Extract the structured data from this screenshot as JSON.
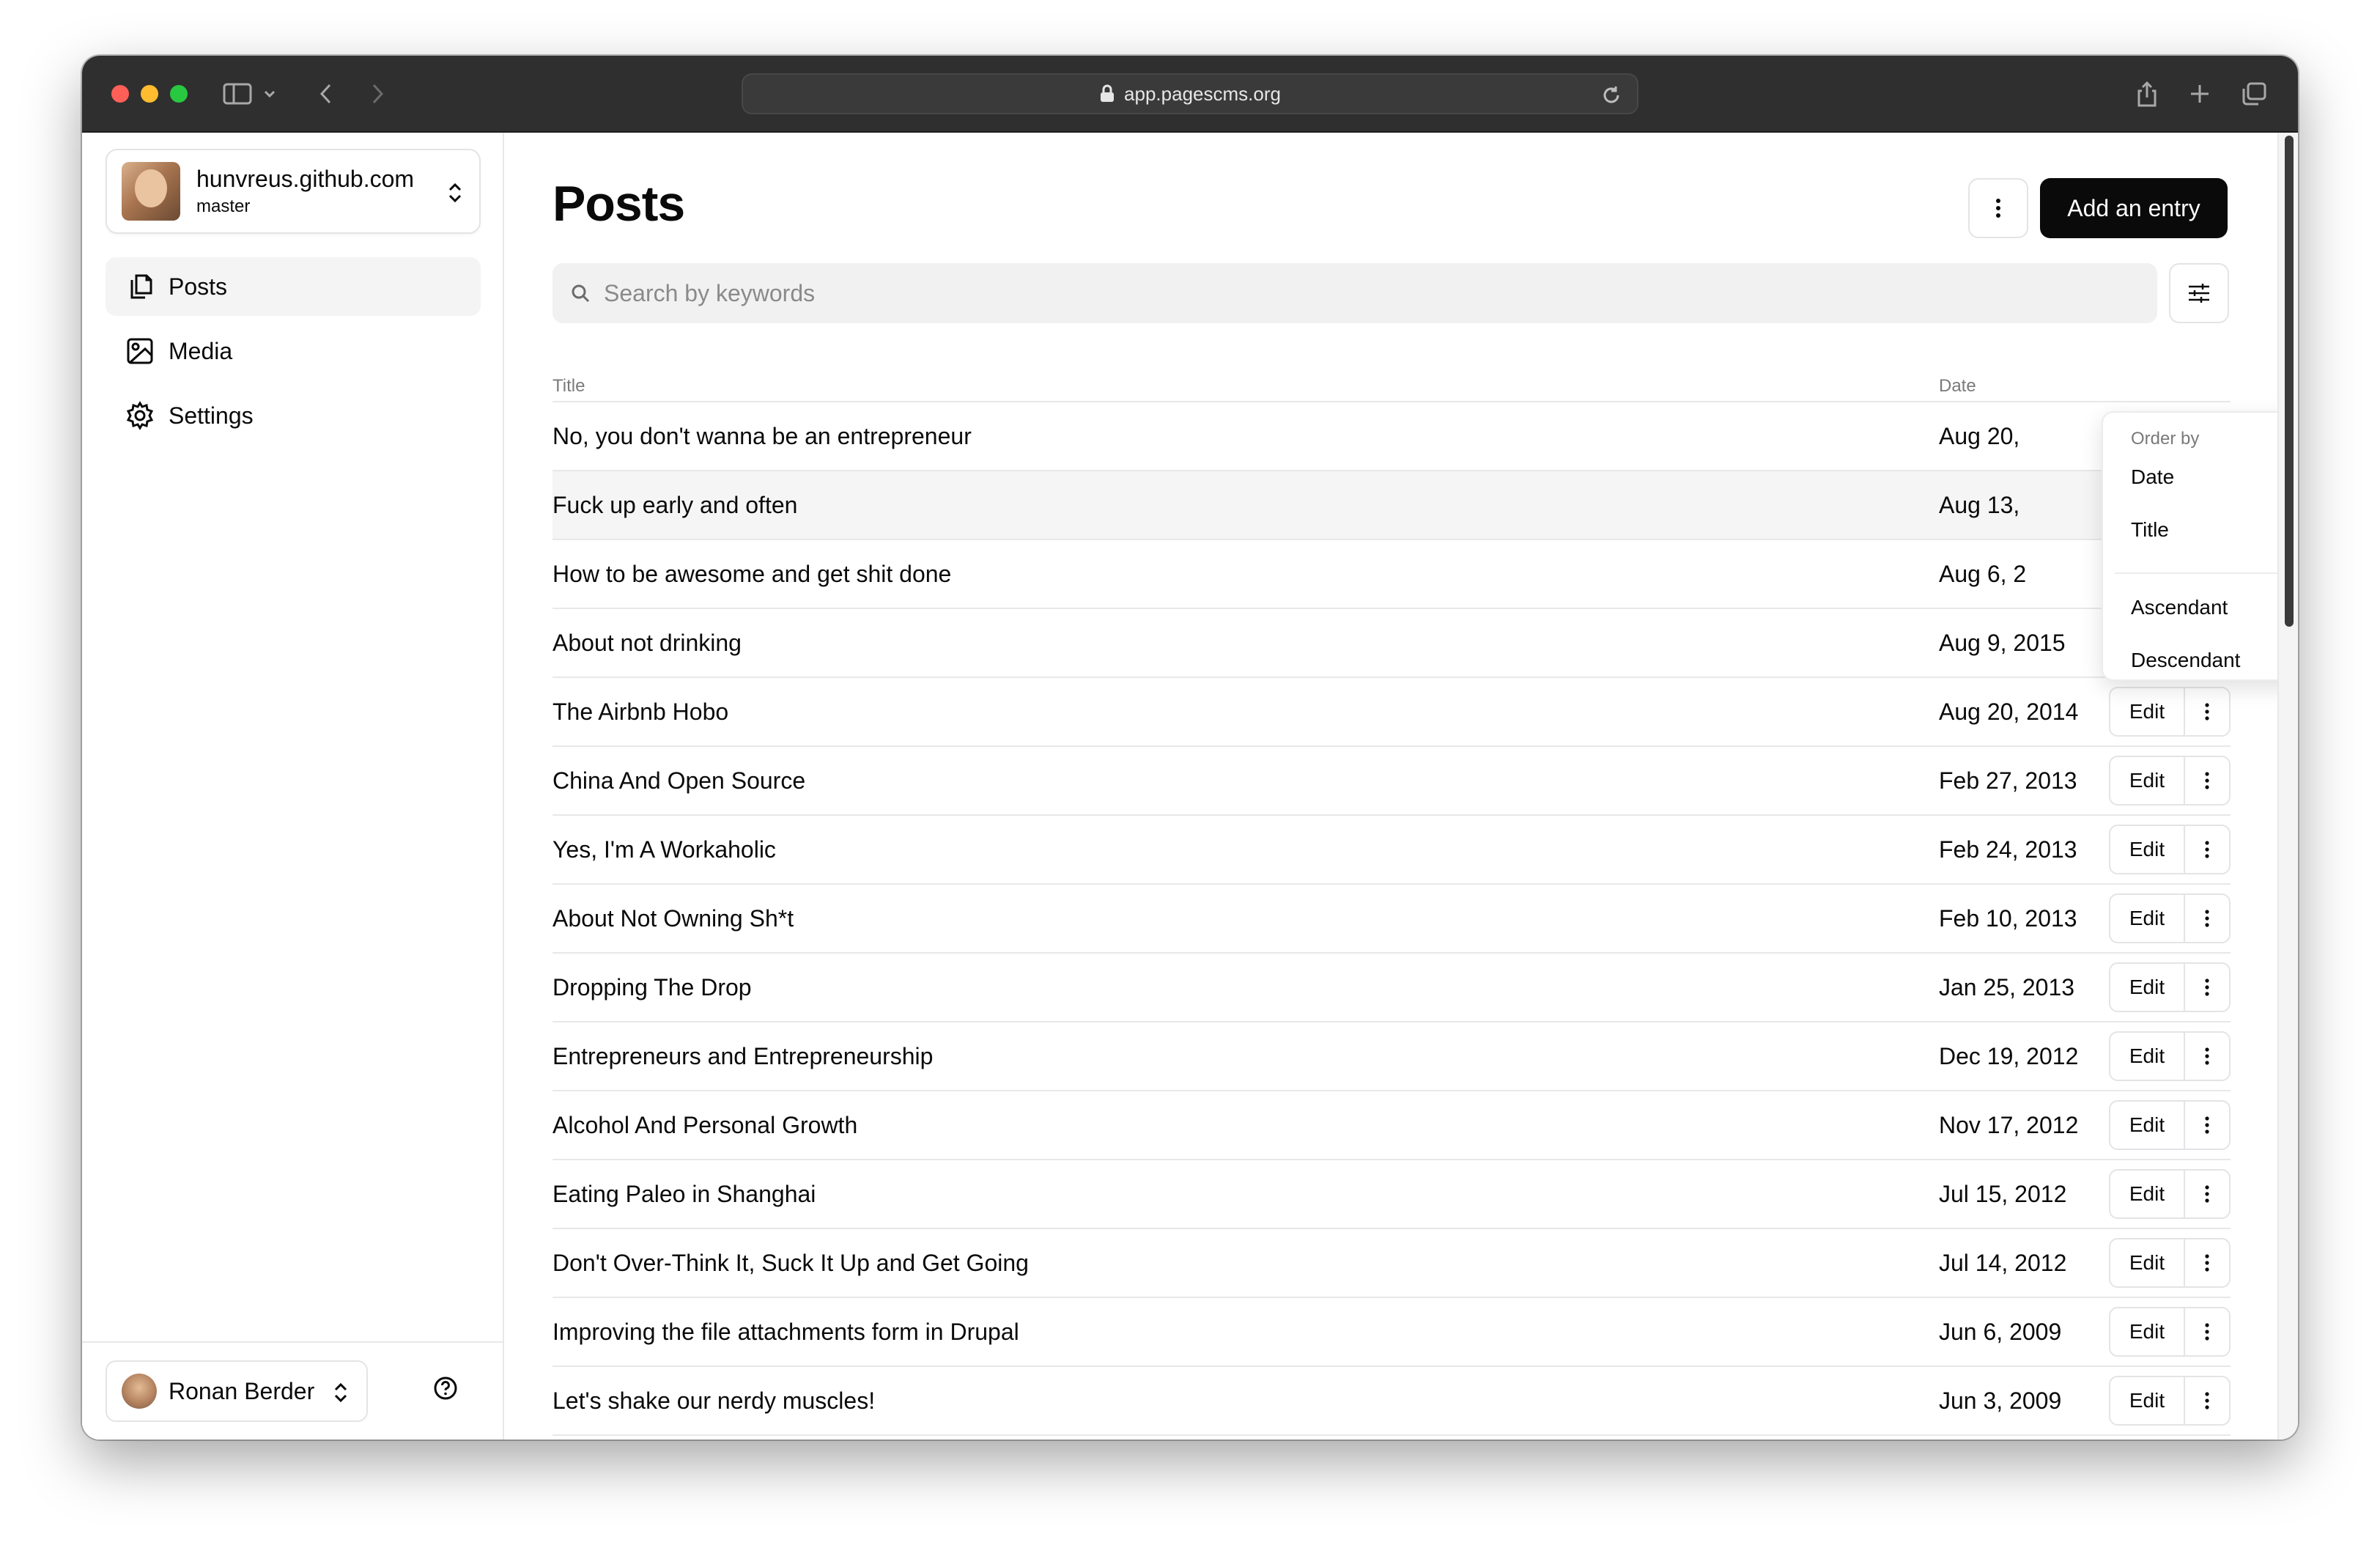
{
  "browser": {
    "url": "app.pagescms.org"
  },
  "sidebar": {
    "repo": {
      "name": "hunvreus.github.com",
      "branch": "master"
    },
    "items": [
      {
        "label": "Posts",
        "icon": "files-icon",
        "active": true
      },
      {
        "label": "Media",
        "icon": "image-icon",
        "active": false
      },
      {
        "label": "Settings",
        "icon": "gear-icon",
        "active": false
      }
    ],
    "user": {
      "name": "Ronan Berder"
    }
  },
  "main": {
    "title": "Posts",
    "add_label": "Add an entry",
    "search_placeholder": "Search by keywords",
    "columns": {
      "title": "Title",
      "date": "Date"
    },
    "edit_label": "Edit",
    "rows": [
      {
        "title": "No, you don't wanna be an entrepreneur",
        "date": "Aug 20,"
      },
      {
        "title": "Fuck up early and often",
        "date": "Aug 13,"
      },
      {
        "title": "How to be awesome and get shit done",
        "date": "Aug 6, 2"
      },
      {
        "title": "About not drinking",
        "date": "Aug 9, 2015"
      },
      {
        "title": "The Airbnb Hobo",
        "date": "Aug 20, 2014"
      },
      {
        "title": "China And Open Source",
        "date": "Feb 27, 2013"
      },
      {
        "title": "Yes, I'm A Workaholic",
        "date": "Feb 24, 2013"
      },
      {
        "title": "About Not Owning Sh*t",
        "date": "Feb 10, 2013"
      },
      {
        "title": "Dropping The Drop",
        "date": "Jan 25, 2013"
      },
      {
        "title": "Entrepreneurs and Entrepreneurship",
        "date": "Dec 19, 2012"
      },
      {
        "title": "Alcohol And Personal Growth",
        "date": "Nov 17, 2012"
      },
      {
        "title": "Eating Paleo in Shanghai",
        "date": "Jul 15, 2012"
      },
      {
        "title": "Don't Over-Think It, Suck It Up and Get Going",
        "date": "Jul 14, 2012"
      },
      {
        "title": "Improving the file attachments form in Drupal",
        "date": "Jun 6, 2009"
      },
      {
        "title": "Let's shake our nerdy muscles!",
        "date": "Jun 3, 2009"
      }
    ]
  },
  "sort_menu": {
    "label": "Order by",
    "fields": [
      {
        "label": "Date",
        "checked": true
      },
      {
        "label": "Title",
        "checked": false
      }
    ],
    "directions": [
      {
        "label": "Ascendant",
        "checked": false
      },
      {
        "label": "Descendant",
        "checked": true
      }
    ]
  },
  "colors": {
    "primary": "#0a0a0a",
    "border": "#e4e4e7",
    "muted_bg": "#f4f4f5",
    "titlebar": "#2f2f2f"
  }
}
